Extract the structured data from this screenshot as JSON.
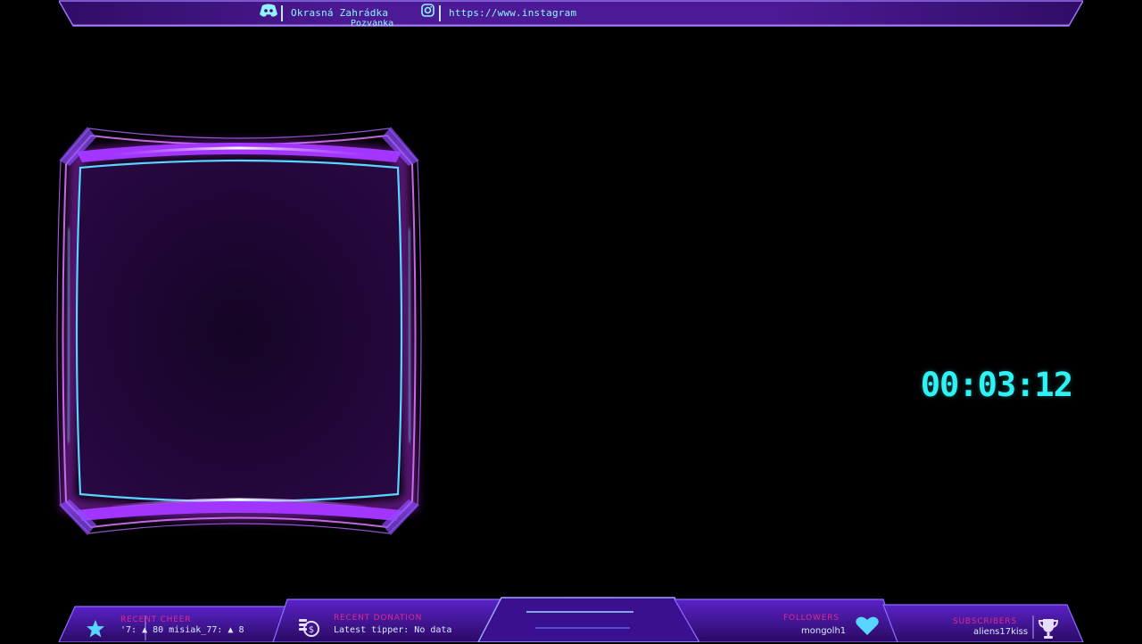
{
  "top_bar": {
    "discord_icon": "discord-icon",
    "discord_text": "Okrasná Zahrádka",
    "discord_subtext": "Pozvánka",
    "instagram_icon": "instagram-icon",
    "instagram_text": "https://www.instagram"
  },
  "timer": {
    "value": "00:03:12"
  },
  "bottom_bar": {
    "recent_cheer": {
      "icon": "star-icon",
      "label": "RECENT CHEER",
      "ticker": "'7:  ▲ 80   misiak_77:  ▲ 8"
    },
    "recent_donation": {
      "icon": "coins-icon",
      "label": "RECENT DONATION",
      "value": "Latest tipper: No data"
    },
    "followers": {
      "icon": "heart-icon",
      "label": "FOLLOWERS",
      "value": "mongolh1"
    },
    "subscribers": {
      "icon": "trophy-icon",
      "label": "SUBSCRIBERS",
      "value": "aliens17kiss"
    }
  },
  "colors": {
    "purple": "#7a2fd0",
    "magenta": "#e0298c",
    "cyan": "#2ff2f5",
    "frame_glow": "#d05cff"
  }
}
